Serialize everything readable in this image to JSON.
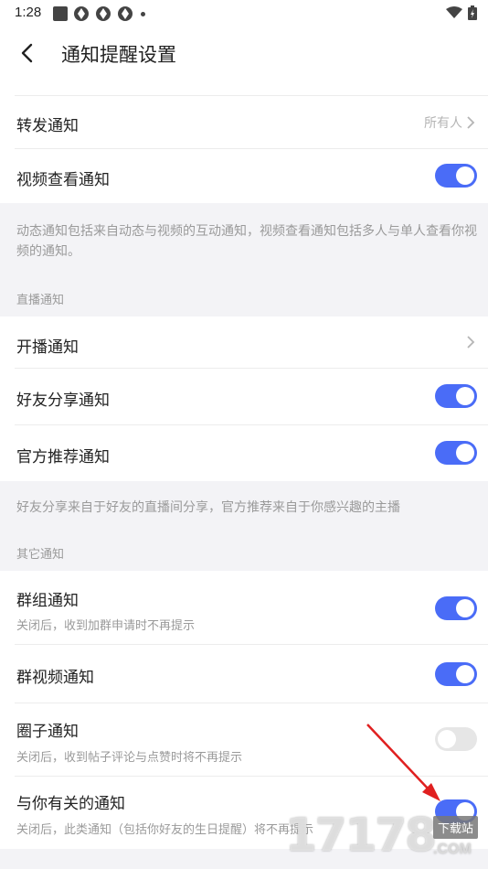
{
  "status_bar": {
    "time": "1:28",
    "icons": [
      "notification-square-icon",
      "app-icon",
      "app-icon",
      "app-icon",
      "dot-icon",
      "wifi-icon",
      "battery-icon"
    ]
  },
  "header": {
    "title": "通知提醒设置",
    "back_icon": "chevron-left-icon"
  },
  "rows_top": [
    {
      "label": "转发通知",
      "value": "所有人",
      "type": "nav"
    },
    {
      "label": "视频查看通知",
      "type": "toggle",
      "on": true
    }
  ],
  "info1": "动态通知包括来自动态与视频的互动通知，视频查看通知包括多人与单人查看你视频的通知。",
  "live": {
    "header": "直播通知",
    "rows": [
      {
        "label": "开播通知",
        "type": "nav"
      },
      {
        "label": "好友分享通知",
        "type": "toggle",
        "on": true
      },
      {
        "label": "官方推荐通知",
        "type": "toggle",
        "on": true
      }
    ],
    "info": "好友分享来自于好友的直播间分享，官方推荐来自于你感兴趣的主播"
  },
  "other": {
    "header": "其它通知",
    "rows": [
      {
        "label": "群组通知",
        "sub": "关闭后，收到加群申请时不再提示",
        "on": true
      },
      {
        "label": "群视频通知",
        "sub": "",
        "on": true
      },
      {
        "label": "圈子通知",
        "sub": "关闭后，收到帖子评论与点赞时将不再提示",
        "on": false
      },
      {
        "label": "与你有关的通知",
        "sub": "关闭后，此类通知（包括你好友的生日提醒）将不再提示",
        "on": true
      }
    ]
  },
  "watermark": {
    "logo": "17178",
    "tag": "下载站",
    "domain": ".COM"
  },
  "colors": {
    "accent": "#4a6cf7",
    "toggle_off": "#e6e6e6",
    "band_bg": "#f3f3f6",
    "annotation_arrow": "#e02020"
  }
}
